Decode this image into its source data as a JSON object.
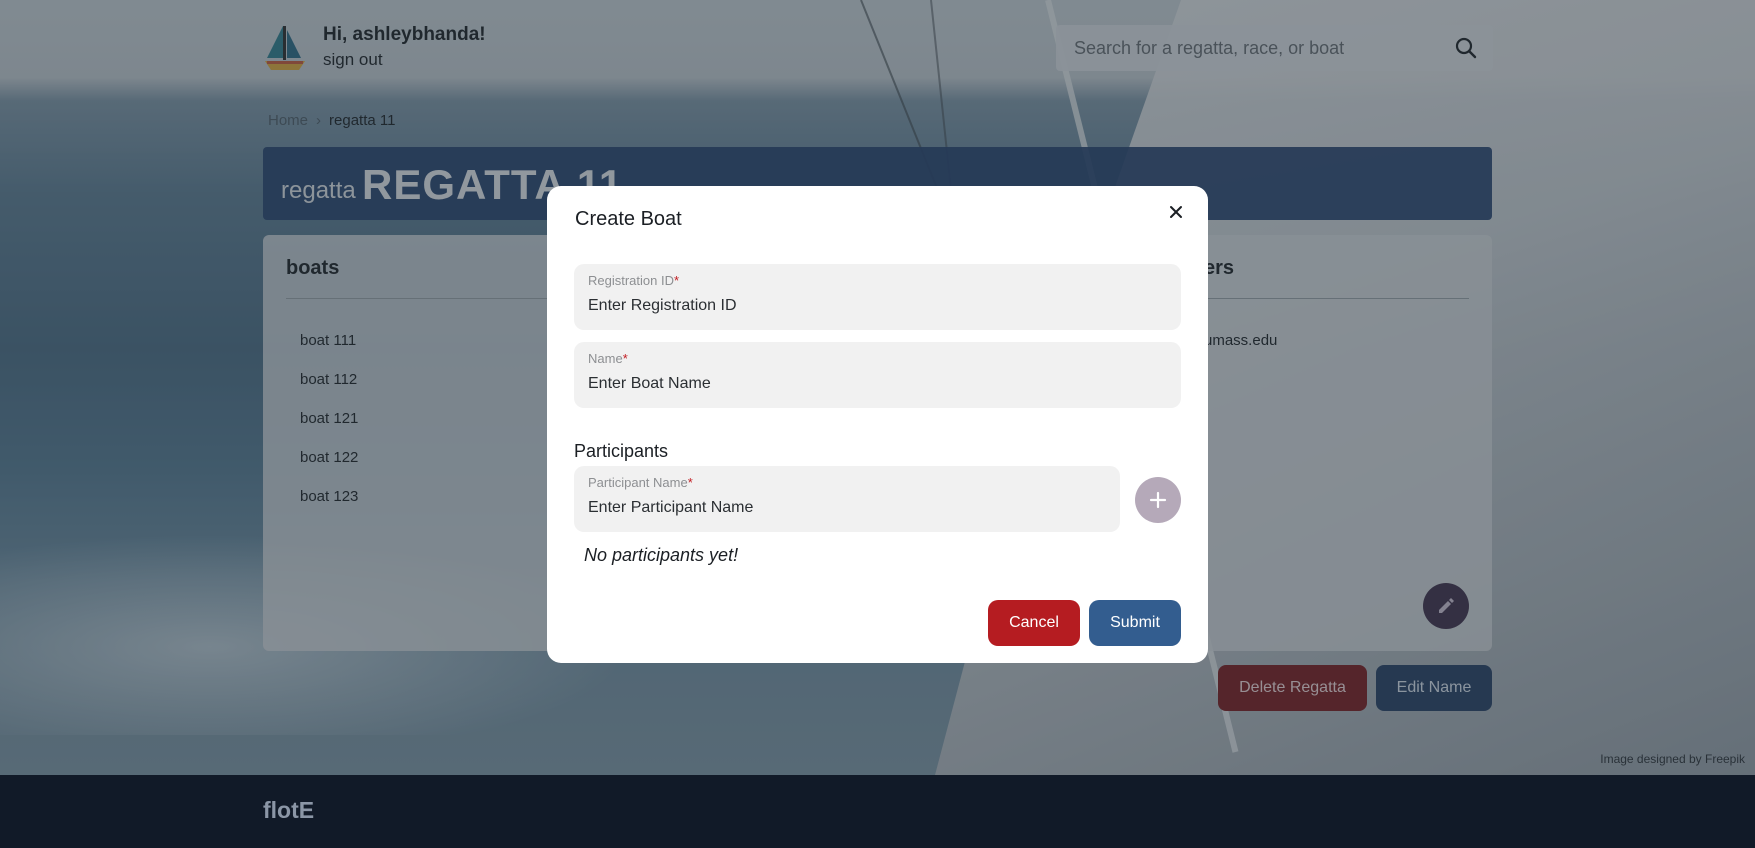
{
  "header": {
    "greeting": "Hi, ashleybhanda!",
    "sign_out": "sign out",
    "search_placeholder": "Search for a regatta, race, or boat",
    "logo_icon": "sailboat-icon"
  },
  "breadcrumb": {
    "home": "Home",
    "current": "regatta 11"
  },
  "banner": {
    "type_label": "regatta",
    "name": "REGATTA 11"
  },
  "card": {
    "boats_title": "boats",
    "boats": [
      "boat 111",
      "boat 112",
      "boat 121",
      "boat 122",
      "boat 123"
    ],
    "right_title_fragment": "ers",
    "email_fragment": "umass.edu"
  },
  "actions": {
    "delete": "Delete Regatta",
    "edit": "Edit Name"
  },
  "credit": "Image designed by Freepik",
  "footer": {
    "brand": "flotE"
  },
  "modal": {
    "title": "Create Boat",
    "registration": {
      "label": "Registration ID",
      "required_mark": "*",
      "placeholder": "Enter Registration ID"
    },
    "name": {
      "label": "Name",
      "required_mark": "*",
      "placeholder": "Enter Boat Name"
    },
    "participants_heading": "Participants",
    "participant": {
      "label": "Participant Name",
      "required_mark": "*",
      "placeholder": "Enter Participant Name"
    },
    "empty_text": "No participants yet!",
    "cancel": "Cancel",
    "submit": "Submit"
  },
  "colors": {
    "primary": "#335d8f",
    "danger": "#b51c21",
    "banner": "#24406c",
    "footer": "#111a28"
  }
}
